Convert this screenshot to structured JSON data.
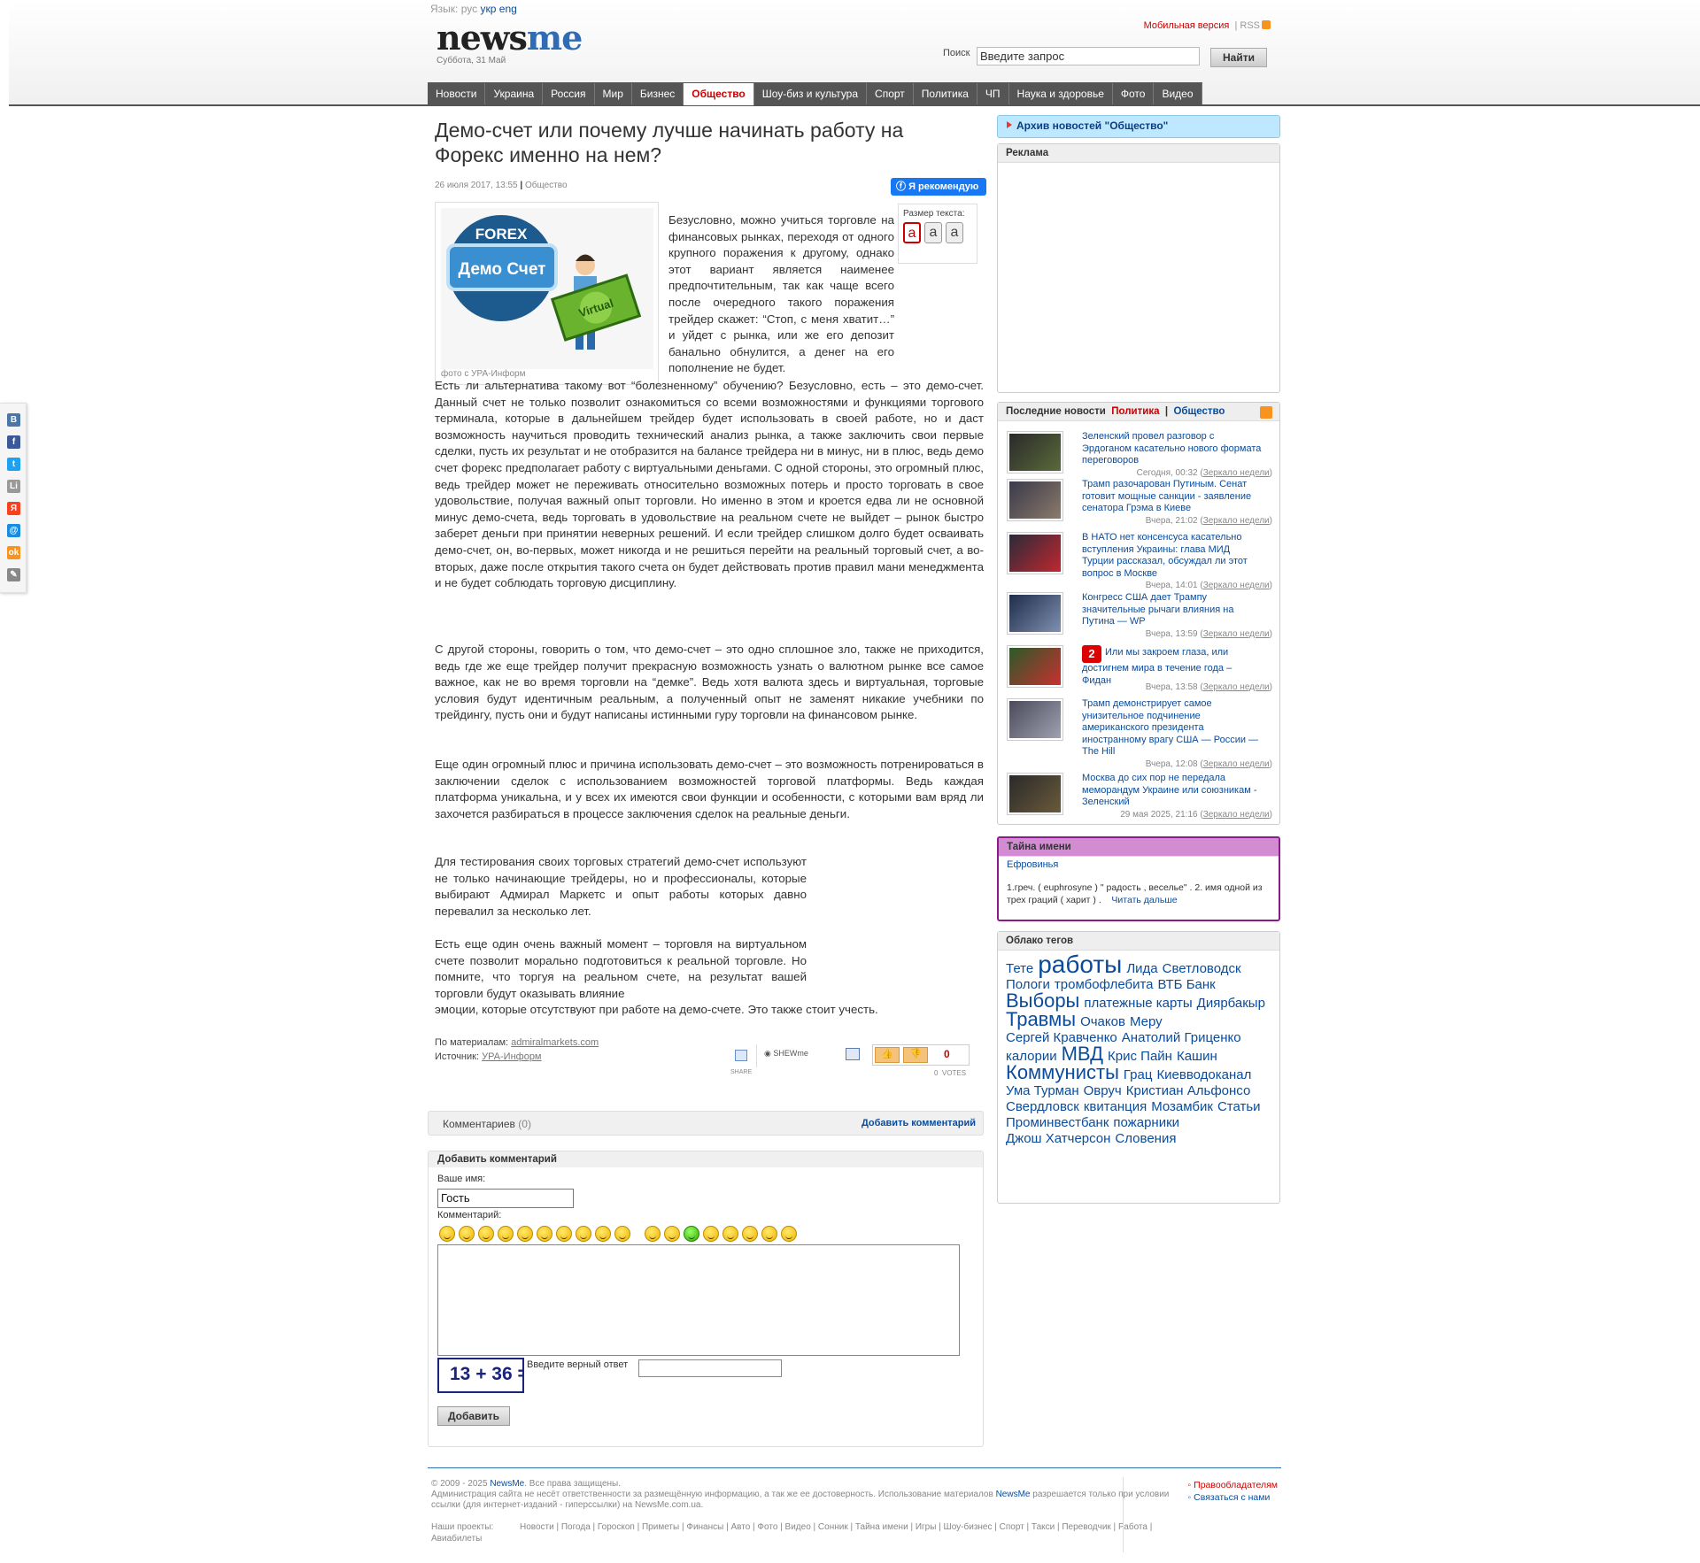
{
  "header": {
    "lang_label": "Язык:",
    "lang_ru": "рус",
    "lang_uk": "укр",
    "lang_en": "eng",
    "logo_part1": "news",
    "logo_part2": "me",
    "date": "Суббота, 31 Май",
    "mobile": "Мобильная версия",
    "rss": "RSS",
    "search_label": "Поиск",
    "search_placeholder": "Введите запрос",
    "search_button": "Найти"
  },
  "nav": [
    "Новости",
    "Украина",
    "Россия",
    "Мир",
    "Бизнес",
    "Общество",
    "Шоу-биз и культура",
    "Спорт",
    "Политика",
    "ЧП",
    "Наука и здоровье",
    "Фото",
    "Видео"
  ],
  "nav_active": "Общество",
  "article": {
    "title": "Демо-счет или почему лучше начинать работу на Форекс именно на нем?",
    "date": "26 июля 2017, 13:55",
    "category": "Общество",
    "fb_button": "Я рекомендую",
    "photo_text1": "FOREX",
    "photo_text2": "Демо Счет",
    "photo_text3": "Virtual",
    "photo_caption": "фото с УРА-Информ",
    "textsize_label": "Размер текста:",
    "textsize_letter": "a",
    "p1": "Безусловно, можно учиться торговле на финансовых рынках, переходя от одного крупного поражения к другому, однако этот вариант является наименее предпочтительным, так как чаще всего после очередного такого поражения трейдер скажет: “Стоп, с меня хватит…” и уйдет с рынка, или же его депозит банально обнулится, а денег на его пополнение не будет.",
    "p2": "Есть ли альтернатива такому вот “болезненному” обучению? Безусловно, есть – это демо-счет. Данный счет не только позволит ознакомиться со всеми возможностями и функциями торгового терминала, которые в дальнейшем трейдер будет использовать в своей работе, но и даст возможность научиться проводить технический анализ рынка, а также заключить свои первые сделки, пусть их результат и не отобразится на балансе трейдера ни в минус, ни в плюс, ведь демо счет форекс предполагает работу с виртуальными деньгами. С одной стороны, это огромный плюс, ведь трейдер может не переживать относительно возможных потерь и просто торговать в свое удовольствие, получая важный опыт торговли. Но именно в этом и кроется едва ли не основной минус демо-счета, ведь торговать в удовольствие на реальном счете не выйдет – рынок быстро заберет деньги при принятии неверных решений. И если трейдер слишком долго будет осваивать демо-счет, он, во-первых, может никогда и не решиться перейти на реальный торговый счет, а во-вторых, даже после открытия такого счета он будет действовать против правил мани менеджмента и не будет соблюдать торговую дисциплину.",
    "p3": "С другой стороны, говорить о том, что демо-счет – это одно сплошное зло, также не приходится, ведь где же еще трейдер получит прекрасную возможность узнать о валютном рынке все самое важное, как не во время торговли на “демке”. Ведь хотя валюта здесь и виртуальная, торговые условия будут идентичным реальным, а полученный опыт не заменят никакие учебники по трейдингу, пусть они и будут написаны истинными гуру торговли на финансовом рынке.",
    "p4": "Еще один огромный плюс и причина использовать демо-счет – это возможность потренироваться в заключении сделок с использованием возможностей торговой платформы. Ведь каждая платформа уникальна, и у всех их имеются свои функции и особенности, с которыми вам вряд ли захочется разбираться в процессе заключения сделок на реальные деньги.",
    "p5": "Для тестирования своих торговых стратегий демо-счет используют не только начинающие трейдеры, но и профессионалы, которые выбирают Адмирал Маркетс и опыт работы которых давно перевалил за несколько лет.",
    "p6a": "Есть еще один очень важный момент – торговля на виртуальном счете позволит морально подготовиться к реальной торговле. Но помните, что торгуя на реальном счете, на результат вашей торговли будут оказывать влияние",
    "p6b": "эмоции, которые отсутствуют при работе на демо-счете. Это также стоит учесть.",
    "source1_label": "По материалам:",
    "source1": "admiralmarkets.com",
    "source2_label": "Источник:",
    "source2": "УРА-Информ",
    "share_label": "SHARE",
    "shewme": "SHEWme",
    "votes_count": "0",
    "votes_label": "VOTES",
    "votes_value": "0"
  },
  "comments": {
    "label": "Комментариев",
    "count": "(0)",
    "add_link": "Добавить комментарий",
    "form_title": "Добавить комментарий",
    "name_label": "Ваше имя:",
    "name_value": "Гость",
    "comment_label": "Комментарий:",
    "captcha": "13 + 36 =",
    "captcha_label": "Введите верный ответ",
    "submit": "Добавить"
  },
  "sidebar": {
    "archive": "Архив новостей \"Общество\"",
    "ads_title": "Реклама",
    "news_title": "Последние новости",
    "news_tab1": "Политика",
    "news_tab2": "Общество",
    "news": [
      {
        "text": "Зеленский провел разговор с Эрдоганом касательно нового формата переговоров",
        "date": "Сегодня, 00:32 (",
        "mirror": "Зеркало недели",
        "close": ")"
      },
      {
        "text": "Трамп разочарован Путиным. Сенат готовит мощные санкции - заявление сенатора Грэма в Киеве",
        "date": "Вчера, 21:02 (",
        "mirror": "Зеркало недели",
        "close": ")"
      },
      {
        "text": "В НАТО нет консенсуса касательно вступления Украины: глава МИД Турции рассказал, обсуждал ли этот вопрос в Москве",
        "date": "Вчера, 14:01 (",
        "mirror": "Зеркало недели",
        "close": ")"
      },
      {
        "text": "Конгресс США дает Трампу значительные рычаги влияния на Путина — WP",
        "date": "Вчера, 13:59 (",
        "mirror": "Зеркало недели",
        "close": ")"
      },
      {
        "text": "Или мы закроем глаза, или достигнем мира в течение года – Фидан",
        "badge": "2",
        "date": "Вчера, 13:58 (",
        "mirror": "Зеркало недели",
        "close": ")"
      },
      {
        "text": "Трамп демонстрирует самое унизительное подчинение американского президента иностранному врагу США — России — The Hill",
        "date": "Вчера, 12:08 (",
        "mirror": "Зеркало недели",
        "close": ")"
      },
      {
        "text": "Москва до сих пор не передала меморандум Украине или союзникам - Зеленский",
        "date": "29 мая 2025, 21:16 (",
        "mirror": "Зеркало недели",
        "close": ")"
      }
    ],
    "name_title": "Тайна имени",
    "name": "Ефровинья",
    "name_desc": "1.греч. ( euphrosyne ) \" радость , веселье\" . 2. имя одной из трех граций ( харит ) .",
    "name_more": "Читать дальше",
    "tags_title": "Облако тегов",
    "tags": [
      "Тете",
      "работы",
      "Лида",
      "Светловодск",
      "Пологи",
      "тромбофлебита",
      "ВТБ Банк",
      "Выборы",
      "платежные карты",
      "Диярбакыр",
      "Травмы",
      "Очаков",
      "Меру",
      "Сергей Кравченко",
      "Анатолий Гриценко",
      "калории",
      "МВД",
      "Крис Пайн",
      "Кашин",
      "Коммунисты",
      "Грац",
      "Киевводоканал",
      "Ума Турман",
      "Овруч",
      "Кристиан Альфонсо",
      "Свердловск",
      "квитанция",
      "Мозамбик",
      "Статьи",
      "Проминвестбанк",
      "пожарники",
      "Джош Хатчерсон",
      "Словения"
    ]
  },
  "social_icons": [
    "В",
    "f",
    "t",
    "Li",
    "Я",
    "@",
    "ok",
    "✎"
  ],
  "footer": {
    "copyright_a": "© 2009 - 2025 ",
    "brand": "NewsMe",
    "copyright_b": ". Все права защищены.",
    "disclaimer_a": "Администрация сайта не несёт ответственности за размещённую информацию, а так же ее достоверность. Использование материалов ",
    "disclaimer_b": " разрешается только при условии ссылки (для интернет-изданий - гиперссылки) на NewsMe.com.ua.",
    "projects_label": "Наши проекты:",
    "projects": "Новости | Погода | Гороскоп | Приметы | Финансы | Авто | Фото | Видео | Сонник | Тайна имени | Игры | Шоу-бизнес | Спорт | Такси | Переводчик | Работа | Авиабилеты",
    "link1": "Правообладателям",
    "link2": "Связаться с нами"
  }
}
